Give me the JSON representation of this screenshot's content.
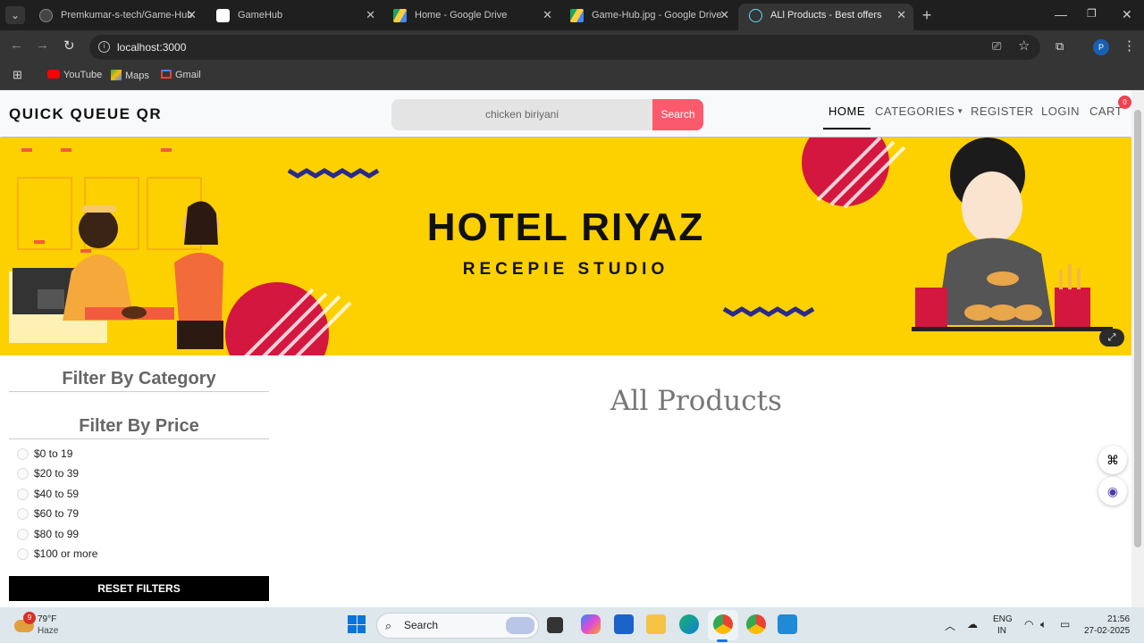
{
  "browser": {
    "tabs": [
      {
        "title": "Premkumar-s-tech/Game-Hub",
        "icon": "github-icon"
      },
      {
        "title": "GameHub",
        "icon": "gamehub-icon"
      },
      {
        "title": "Home - Google Drive",
        "icon": "google-drive-icon"
      },
      {
        "title": "Game-Hub.jpg - Google Drive",
        "icon": "google-drive-icon"
      },
      {
        "title": "ALl Products - Best offers",
        "icon": "react-icon",
        "active": true
      }
    ],
    "url": "localhost:3000",
    "bookmarks": [
      {
        "label": "YouTube",
        "icon": "youtube-icon"
      },
      {
        "label": "Maps",
        "icon": "maps-icon"
      },
      {
        "label": "Gmail",
        "icon": "gmail-icon"
      }
    ],
    "profile_initial": "P"
  },
  "navbar": {
    "brand": "QUICK QUEUE QR",
    "search_value": "chicken biriyani",
    "search_button": "Search",
    "links": [
      "HOME",
      "CATEGORIES",
      "REGISTER",
      "LOGIN",
      "CART"
    ],
    "cart_count": "0"
  },
  "banner": {
    "title": "HOTEL RIYAZ",
    "subtitle": "RECEPIE STUDIO",
    "background_color": "#fdd000"
  },
  "filters": {
    "category_heading": "Filter By Category",
    "price_heading": "Filter By Price",
    "price_options": [
      "$0 to 19",
      "$20 to 39",
      "$40 to 59",
      "$60 to 79",
      "$80 to 99",
      "$100 or more"
    ],
    "reset_label": "RESET FILTERS"
  },
  "main": {
    "heading": "All Products"
  },
  "taskbar": {
    "weather_temp": "79°F",
    "weather_desc": "Haze",
    "weather_badge": "9",
    "search_label": "Search",
    "lang_top": "ENG",
    "lang_bottom": "IN",
    "time": "21:56",
    "date": "27-02-2025"
  }
}
